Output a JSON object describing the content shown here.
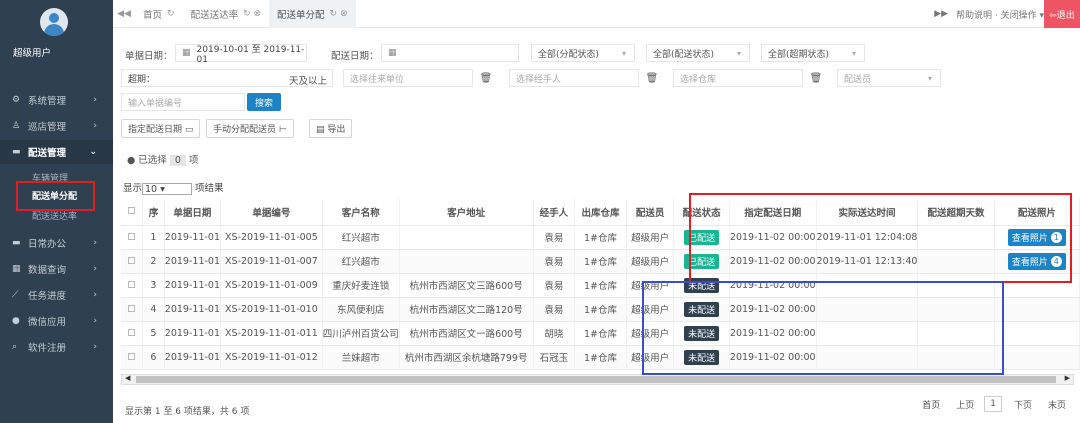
{
  "sidebar": {
    "username": "超级用户",
    "items": [
      {
        "icon": "⚙",
        "label": "系统管理",
        "arrow": "›"
      },
      {
        "icon": "♙",
        "label": "巡店管理",
        "arrow": "›"
      },
      {
        "icon": "▬",
        "label": "配送管理",
        "arrow": "⌄"
      },
      {
        "icon": "▬",
        "label": "日常办公",
        "arrow": "›"
      },
      {
        "icon": "▦",
        "label": "数据查询",
        "arrow": "›"
      },
      {
        "icon": "⟋",
        "label": "任务进度",
        "arrow": "›"
      },
      {
        "icon": "●",
        "label": "微信应用",
        "arrow": "›"
      },
      {
        "icon": "⌕",
        "label": "软件注册",
        "arrow": "›"
      }
    ],
    "subitems": [
      "车辆管理",
      "配送单分配",
      "配送送达率"
    ]
  },
  "topbar": {
    "back": "◀◀",
    "tabs": [
      {
        "label": "首页",
        "glyph": "↻"
      },
      {
        "label": "配送送达率",
        "glyph": "↻ ⊗"
      },
      {
        "label": "配送单分配",
        "glyph": "↻ ⊗"
      }
    ],
    "forward": "▶▶",
    "right_text": "帮助说明 · 关闭操作 ▾",
    "logout": "⇦退出"
  },
  "filters": {
    "doc_date_label": "单据日期：",
    "doc_date_value": "2019-10-01 至 2019-11-01",
    "delivery_date_label": "配送日期：",
    "alloc_status": "全部(分配状态)",
    "delivery_status": "全部(配送状态)",
    "overdue_status": "全部(超期状态)",
    "overdue_label": "超期：",
    "days_suffix": "天及以上",
    "unit_placeholder": "选择往来单位",
    "handler_placeholder": "选择经手人",
    "warehouse_placeholder": "选择仓库",
    "deliverer_placeholder": "配送员",
    "docno_placeholder": "输入单据编号",
    "search": "搜索",
    "assign_date": "指定配送日期 ▭",
    "assign_person": "手动分配配送员 ⊢",
    "export": "▤ 导出",
    "selected_prefix": "● 已选择",
    "selected_count": "0",
    "selected_suffix": "项",
    "show_prefix": "显示",
    "show_value": "10    ▾",
    "show_suffix": "项结果"
  },
  "table": {
    "headers": [
      "序",
      "单据日期",
      "单据编号",
      "客户名称",
      "客户地址",
      "经手人",
      "出库仓库",
      "配送员",
      "配送状态",
      "指定配送日期",
      "实际送达时间",
      "配送超期天数",
      "配送照片"
    ],
    "rows": [
      {
        "no": "1",
        "date": "2019-11-01",
        "code": "XS-2019-11-01-005",
        "customer": "红兴超市",
        "address": "",
        "handler": "袁易",
        "warehouse": "1#仓库",
        "deliverer": "超级用户",
        "status": "已配送",
        "status_color": "#1ab394",
        "assigned": "2019-11-02 00:00",
        "actual": "2019-11-01 12:04:08",
        "overdue": "",
        "photo": "查看照片",
        "photo_count": "1"
      },
      {
        "no": "2",
        "date": "2019-11-01",
        "code": "XS-2019-11-01-007",
        "customer": "红兴超市",
        "address": "",
        "handler": "袁易",
        "warehouse": "1#仓库",
        "deliverer": "超级用户",
        "status": "已配送",
        "status_color": "#1ab394",
        "assigned": "2019-11-02 00:00",
        "actual": "2019-11-01 12:13:40",
        "overdue": "",
        "photo": "查看照片",
        "photo_count": "4"
      },
      {
        "no": "3",
        "date": "2019-11-01",
        "code": "XS-2019-11-01-009",
        "customer": "重庆好麦连锁",
        "address": "杭州市西湖区文三路600号",
        "handler": "袁易",
        "warehouse": "1#仓库",
        "deliverer": "超级用户",
        "status": "未配送",
        "status_color": "#2f4050",
        "assigned": "2019-11-02 00:00",
        "actual": "",
        "overdue": "",
        "photo": "",
        "photo_count": ""
      },
      {
        "no": "4",
        "date": "2019-11-01",
        "code": "XS-2019-11-01-010",
        "customer": "东风便利店",
        "address": "杭州市西湖区文二路120号",
        "handler": "袁易",
        "warehouse": "1#仓库",
        "deliverer": "超级用户",
        "status": "未配送",
        "status_color": "#2f4050",
        "assigned": "2019-11-02 00:00",
        "actual": "",
        "overdue": "",
        "photo": "",
        "photo_count": ""
      },
      {
        "no": "5",
        "date": "2019-11-01",
        "code": "XS-2019-11-01-011",
        "customer": "四川泸州百货公司",
        "address": "杭州市西湖区文一路600号",
        "handler": "胡晓",
        "warehouse": "1#仓库",
        "deliverer": "超级用户",
        "status": "未配送",
        "status_color": "#2f4050",
        "assigned": "2019-11-02 00:00",
        "actual": "",
        "overdue": "",
        "photo": "",
        "photo_count": ""
      },
      {
        "no": "6",
        "date": "2019-11-01",
        "code": "XS-2019-11-01-012",
        "customer": "兰妹超市",
        "address": "杭州市西湖区余杭塘路799号",
        "handler": "石冠玉",
        "warehouse": "1#仓库",
        "deliverer": "超级用户",
        "status": "未配送",
        "status_color": "#2f4050",
        "assigned": "2019-11-02 00:00",
        "actual": "",
        "overdue": "",
        "photo": "",
        "photo_count": ""
      }
    ]
  },
  "footer": {
    "info": "显示第 1 至 6 项结果，共 6 项",
    "first": "首页",
    "prev": "上页",
    "current": "1",
    "next": "下页",
    "last": "末页"
  },
  "colors": {
    "sidebar": "#2f4050",
    "primary": "#1c84c6",
    "delivered": "#1ab394",
    "pending": "#2f4050",
    "logout": "#ed5565",
    "highlight_red": "#e02020",
    "highlight_blue": "#3b4fc4"
  }
}
